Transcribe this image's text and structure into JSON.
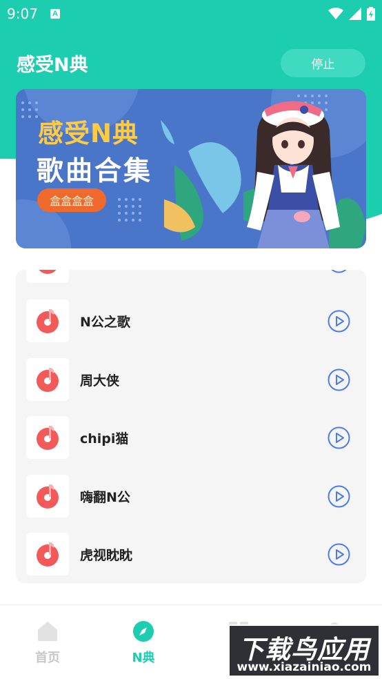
{
  "status_bar": {
    "time": "9:07",
    "notification_icon": "a-icon"
  },
  "header": {
    "title": "感受N典",
    "stop_label": "停止"
  },
  "banner": {
    "title_line1": "感受N典",
    "title_line2": "歌曲合集",
    "tag": "盒盒盒盒"
  },
  "songs": [
    {
      "name": ""
    },
    {
      "name": "N公之歌"
    },
    {
      "name": "周大侠"
    },
    {
      "name": "chipi猫"
    },
    {
      "name": "嗨翻N公"
    },
    {
      "name": "虎视眈眈"
    }
  ],
  "tabs": [
    {
      "label": "首页",
      "icon": "home-icon",
      "active": false
    },
    {
      "label": "N典",
      "icon": "compass-icon",
      "active": true
    },
    {
      "label": "",
      "icon": "grid-icon",
      "active": false
    },
    {
      "label": "",
      "icon": "user-icon",
      "active": false
    }
  ],
  "watermark": {
    "main": "下载鸟应用",
    "url": "www.xiazainiao.com"
  },
  "colors": {
    "accent": "#1ccdb0",
    "banner": "#4a76c9",
    "play": "#4a7cf0",
    "song_icon": "#f25a5a"
  }
}
